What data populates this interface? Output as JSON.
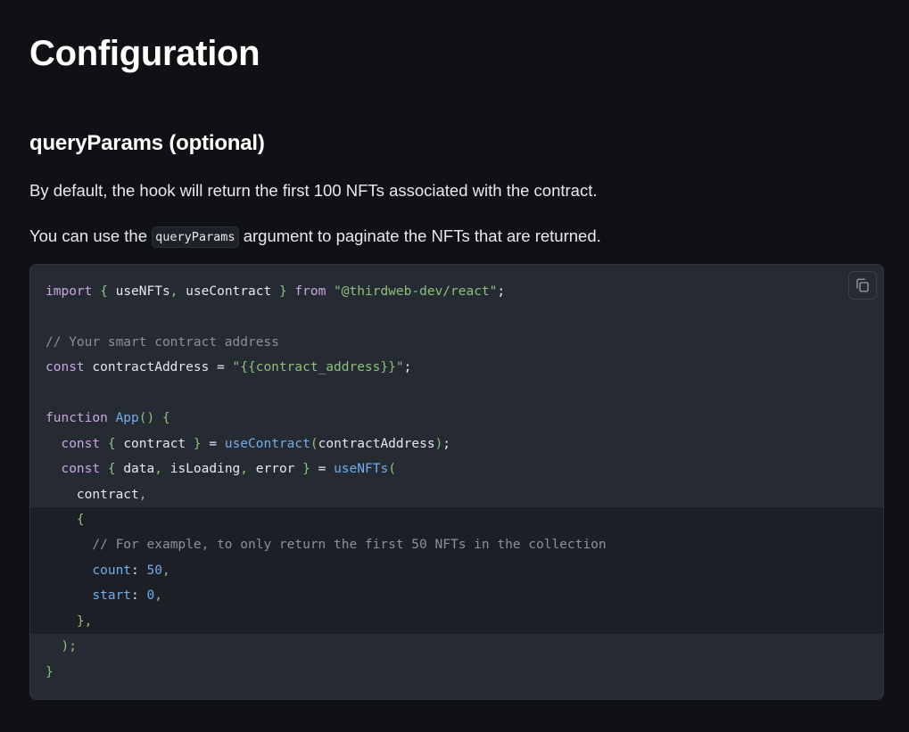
{
  "page": {
    "title": "Configuration",
    "section_heading": "queryParams (optional)",
    "para1": "By default, the hook will return the first 100 NFTs associated with the contract.",
    "para2_before": "You can use the ",
    "para2_code": "queryParams",
    "para2_after": " argument to paginate the NFTs that are returned."
  },
  "code": {
    "copy_icon": "copy-icon",
    "lines": [
      {
        "highlight": false,
        "tokens": [
          [
            "kw",
            "import"
          ],
          [
            "txt",
            " "
          ],
          [
            "pun",
            "{"
          ],
          [
            "txt",
            " useNFTs"
          ],
          [
            "pun",
            ","
          ],
          [
            "txt",
            " useContract "
          ],
          [
            "pun",
            "}"
          ],
          [
            "txt",
            " "
          ],
          [
            "kw",
            "from"
          ],
          [
            "txt",
            " "
          ],
          [
            "str",
            "\"@thirdweb-dev/react\""
          ],
          [
            "txt",
            ";"
          ]
        ]
      },
      {
        "highlight": false,
        "tokens": []
      },
      {
        "highlight": false,
        "tokens": [
          [
            "cm",
            "// Your smart contract address"
          ]
        ]
      },
      {
        "highlight": false,
        "tokens": [
          [
            "kw",
            "const"
          ],
          [
            "txt",
            " contractAddress "
          ],
          [
            "txt",
            "="
          ],
          [
            "txt",
            " "
          ],
          [
            "str",
            "\"{{contract_address}}\""
          ],
          [
            "txt",
            ";"
          ]
        ]
      },
      {
        "highlight": false,
        "tokens": []
      },
      {
        "highlight": false,
        "tokens": [
          [
            "kw",
            "function"
          ],
          [
            "txt",
            " "
          ],
          [
            "fn",
            "App"
          ],
          [
            "pun",
            "()"
          ],
          [
            "txt",
            " "
          ],
          [
            "pun",
            "{"
          ]
        ]
      },
      {
        "highlight": false,
        "tokens": [
          [
            "txt",
            "  "
          ],
          [
            "kw",
            "const"
          ],
          [
            "txt",
            " "
          ],
          [
            "pun",
            "{"
          ],
          [
            "txt",
            " contract "
          ],
          [
            "pun",
            "}"
          ],
          [
            "txt",
            " = "
          ],
          [
            "fn",
            "useContract"
          ],
          [
            "pun",
            "("
          ],
          [
            "txt",
            "contractAddress"
          ],
          [
            "pun",
            ")"
          ],
          [
            "txt",
            ";"
          ]
        ]
      },
      {
        "highlight": false,
        "tokens": [
          [
            "txt",
            "  "
          ],
          [
            "kw",
            "const"
          ],
          [
            "txt",
            " "
          ],
          [
            "pun",
            "{"
          ],
          [
            "txt",
            " data"
          ],
          [
            "pun",
            ","
          ],
          [
            "txt",
            " isLoading"
          ],
          [
            "pun",
            ","
          ],
          [
            "txt",
            " error "
          ],
          [
            "pun",
            "}"
          ],
          [
            "txt",
            " = "
          ],
          [
            "fn",
            "useNFTs"
          ],
          [
            "pun",
            "("
          ]
        ]
      },
      {
        "highlight": false,
        "tokens": [
          [
            "txt",
            "    contract"
          ],
          [
            "pun",
            ","
          ]
        ]
      },
      {
        "highlight": true,
        "tokens": [
          [
            "txt",
            "    "
          ],
          [
            "pun",
            "{"
          ]
        ]
      },
      {
        "highlight": true,
        "tokens": [
          [
            "txt",
            "      "
          ],
          [
            "cm",
            "// For example, to only return the first 50 NFTs in the collection"
          ]
        ]
      },
      {
        "highlight": true,
        "tokens": [
          [
            "txt",
            "      "
          ],
          [
            "prop",
            "count"
          ],
          [
            "txt",
            ": "
          ],
          [
            "num",
            "50"
          ],
          [
            "pun",
            ","
          ]
        ]
      },
      {
        "highlight": true,
        "tokens": [
          [
            "txt",
            "      "
          ],
          [
            "prop",
            "start"
          ],
          [
            "txt",
            ": "
          ],
          [
            "num",
            "0"
          ],
          [
            "pun",
            ","
          ]
        ]
      },
      {
        "highlight": true,
        "tokens": [
          [
            "txt",
            "    "
          ],
          [
            "pun",
            "},"
          ]
        ]
      },
      {
        "highlight": false,
        "tokens": [
          [
            "txt",
            "  "
          ],
          [
            "pun",
            ");"
          ]
        ]
      },
      {
        "highlight": false,
        "tokens": [
          [
            "pun",
            "}"
          ]
        ]
      }
    ]
  }
}
